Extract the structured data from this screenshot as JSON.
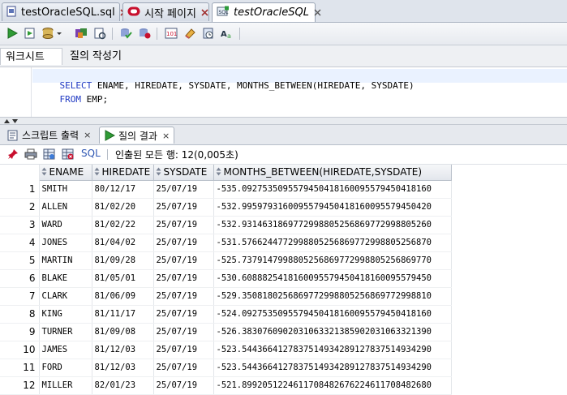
{
  "editor_tabs": [
    {
      "label": "testOracleSQL.sql"
    },
    {
      "label": "시작 페이지"
    },
    {
      "label": "testOracleSQL"
    }
  ],
  "worksheet_tabs": [
    {
      "label": "워크시트"
    },
    {
      "label": "질의 작성기"
    }
  ],
  "sql": {
    "line1_kw": "SELECT",
    "line1_rest": " ENAME, HIREDATE, SYSDATE, MONTHS_BETWEEN(HIREDATE, SYSDATE)",
    "line2_kw": "FROM",
    "line2_rest": " EMP;"
  },
  "result_tabs": [
    {
      "label": "스크립트 출력"
    },
    {
      "label": "질의 결과"
    }
  ],
  "result_toolbar": {
    "sql_label": "SQL",
    "fetch_message": "인출된 모든 행: 12(0,005초)"
  },
  "grid": {
    "columns": [
      "ENAME",
      "HIREDATE",
      "SYSDATE",
      "MONTHS_BETWEEN(HIREDATE,SYSDATE)"
    ],
    "rows": [
      [
        "1",
        "SMITH",
        "80/12/17",
        "25/07/19",
        "-535.0927535095579450418160095579450418160"
      ],
      [
        "2",
        "ALLEN",
        "81/02/20",
        "25/07/19",
        "-532.9959793160095579450418160095579450420"
      ],
      [
        "3",
        "WARD",
        "81/02/22",
        "25/07/19",
        "-532.9314631869772998805256869772998805260"
      ],
      [
        "4",
        "JONES",
        "81/04/02",
        "25/07/19",
        "-531.5766244772998805256869772998805256870"
      ],
      [
        "5",
        "MARTIN",
        "81/09/28",
        "25/07/19",
        "-525.7379147998805256869772998805256869770"
      ],
      [
        "6",
        "BLAKE",
        "81/05/01",
        "25/07/19",
        "-530.6088825418160095579450418160095579450"
      ],
      [
        "7",
        "CLARK",
        "81/06/09",
        "25/07/19",
        "-529.3508180256869772998805256869772998810"
      ],
      [
        "8",
        "KING",
        "81/11/17",
        "25/07/19",
        "-524.0927535095579450418160095579450418160"
      ],
      [
        "9",
        "TURNER",
        "81/09/08",
        "25/07/19",
        "-526.3830760902031063321385902031063321390"
      ],
      [
        "10",
        "JAMES",
        "81/12/03",
        "25/07/19",
        "-523.5443664127837514934289127837514934290"
      ],
      [
        "11",
        "FORD",
        "81/12/03",
        "25/07/19",
        "-523.5443664127837514934289127837514934290"
      ],
      [
        "12",
        "MILLER",
        "82/01/23",
        "25/07/19",
        "-521.8992051224611708482676224611708482680"
      ]
    ]
  }
}
